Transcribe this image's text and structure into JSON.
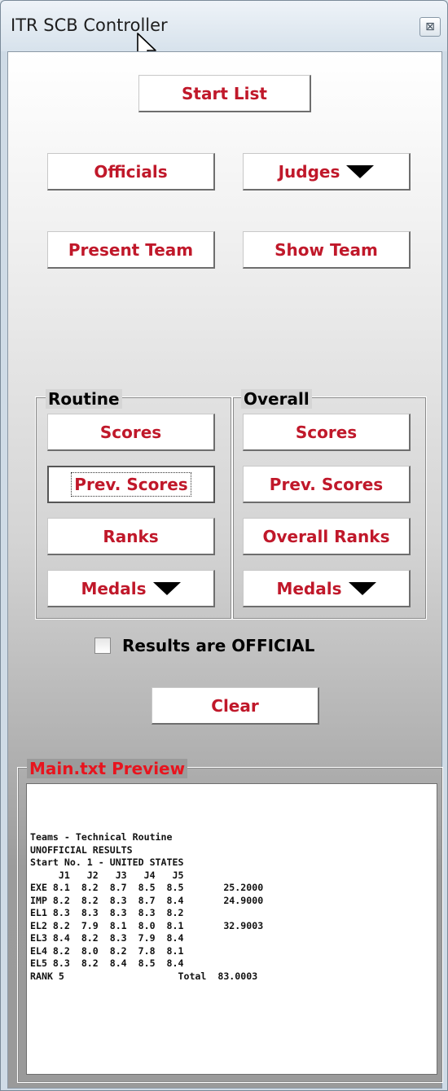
{
  "window": {
    "title": "ITR SCB Controller",
    "close_glyph": "⊠"
  },
  "buttons": {
    "start_list": "Start List",
    "officials": "Officials",
    "judges": "Judges",
    "present_team": "Present Team",
    "show_team": "Show Team",
    "clear": "Clear"
  },
  "routine": {
    "label": "Routine",
    "scores": "Scores",
    "prev_scores": "Prev. Scores",
    "ranks": "Ranks",
    "medals": "Medals"
  },
  "overall": {
    "label": "Overall",
    "scores": "Scores",
    "prev_scores": "Prev. Scores",
    "overall_ranks": "Overall Ranks",
    "medals": "Medals"
  },
  "official_checkbox": {
    "label": "Results are OFFICIAL",
    "checked": false
  },
  "preview": {
    "label": "Main.txt Preview",
    "text": "Teams - Technical Routine\nUNOFFICIAL RESULTS\nStart No. 1 - UNITED STATES\n     J1   J2   J3   J4   J5\nEXE 8.1  8.2  8.7  8.5  8.5       25.2000\nIMP 8.2  8.2  8.3  8.7  8.4       24.9000\nEL1 8.3  8.3  8.3  8.3  8.2\nEL2 8.2  7.9  8.1  8.0  8.1       32.9003\nEL3 8.4  8.2  8.3  7.9  8.4\nEL4 8.2  8.0  8.2  7.8  8.1\nEL5 8.3  8.2  8.4  8.5  8.4\nRANK 5                    Total  83.0003"
  },
  "colors": {
    "button_text": "#c0182a",
    "preview_label": "#e8141e"
  }
}
